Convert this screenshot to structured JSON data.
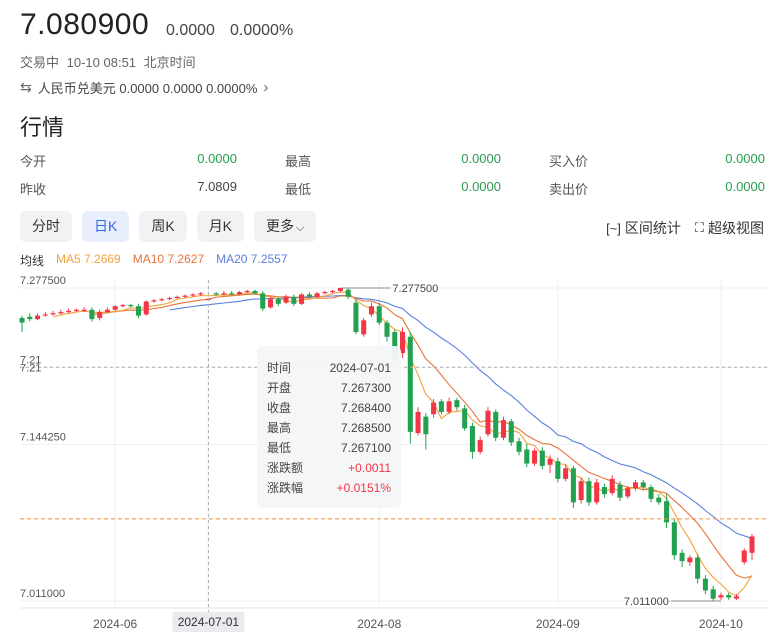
{
  "header": {
    "price": "7.080900",
    "change": "0.0000",
    "change_pct": "0.0000%",
    "status": "交易中",
    "datetime": "10-10 08:51",
    "timezone": "北京时间",
    "pair_icon": "swap-icon",
    "pair_text": "人民币兑美元 0.0000 0.0000 0.0000%"
  },
  "section_title": "行情",
  "quote": [
    {
      "label": "今开",
      "value": "0.0000"
    },
    {
      "label": "最高",
      "value": "0.0000"
    },
    {
      "label": "买入价",
      "value": "0.0000"
    },
    {
      "label": "昨收",
      "value": "7.0809"
    },
    {
      "label": "最低",
      "value": "0.0000"
    },
    {
      "label": "卖出价",
      "value": "0.0000"
    }
  ],
  "tabs": [
    "分时",
    "日K",
    "周K",
    "月K",
    "更多"
  ],
  "active_tab": "日K",
  "tools": {
    "range_stats": "区间统计",
    "super_view": "超级视图"
  },
  "ma": {
    "label": "均线",
    "ma5": "MA5 7.2669",
    "ma10": "MA10 7.2627",
    "ma20": "MA20 7.2557"
  },
  "colors": {
    "up": "#f23645",
    "down": "#22a150",
    "ma5": "#f3a33b",
    "ma10": "#e8743b",
    "ma20": "#5b7fe0",
    "accent": "#3366dd"
  },
  "tooltip": {
    "rows": [
      {
        "k": "时间",
        "v": "2024-07-01"
      },
      {
        "k": "开盘",
        "v": "7.267300"
      },
      {
        "k": "收盘",
        "v": "7.268400"
      },
      {
        "k": "最高",
        "v": "7.268500"
      },
      {
        "k": "最低",
        "v": "7.267100"
      },
      {
        "k": "涨跌额",
        "v": "+0.0011"
      },
      {
        "k": "涨跌幅",
        "v": "+0.0151%"
      }
    ]
  },
  "chart_data": {
    "type": "candlestick",
    "y_ticks": [
      "7.277500",
      "7.21",
      "7.144250",
      "7.011000"
    ],
    "x_ticks": [
      "2024-06",
      "2024-07-01",
      "2024-08",
      "2024-09",
      "2024-10"
    ],
    "ylim": [
      7.011,
      7.2775
    ],
    "high_marker": "7.277500",
    "low_marker": "7.011000",
    "crosshair_x_label": "2024-07-01",
    "crosshair_y_label": "7.21",
    "candles": [
      [
        7.252,
        7.248,
        7.254,
        7.24
      ],
      [
        7.253,
        7.251,
        7.256,
        7.249
      ],
      [
        7.251,
        7.254,
        7.256,
        7.25
      ],
      [
        7.254,
        7.255,
        7.257,
        7.253
      ],
      [
        7.255,
        7.256,
        7.258,
        7.254
      ],
      [
        7.256,
        7.257,
        7.259,
        7.255
      ],
      [
        7.257,
        7.258,
        7.26,
        7.256
      ],
      [
        7.258,
        7.259,
        7.26,
        7.257
      ],
      [
        7.258,
        7.259,
        7.261,
        7.257
      ],
      [
        7.259,
        7.251,
        7.261,
        7.249
      ],
      [
        7.252,
        7.257,
        7.259,
        7.25
      ],
      [
        7.257,
        7.259,
        7.261,
        7.256
      ],
      [
        7.259,
        7.262,
        7.263,
        7.258
      ],
      [
        7.262,
        7.263,
        7.264,
        7.261
      ],
      [
        7.263,
        7.262,
        7.264,
        7.261
      ],
      [
        7.262,
        7.254,
        7.264,
        7.252
      ],
      [
        7.255,
        7.266,
        7.267,
        7.254
      ],
      [
        7.266,
        7.267,
        7.268,
        7.265
      ],
      [
        7.267,
        7.268,
        7.269,
        7.266
      ],
      [
        7.268,
        7.269,
        7.27,
        7.267
      ],
      [
        7.269,
        7.27,
        7.271,
        7.268
      ],
      [
        7.27,
        7.271,
        7.272,
        7.269
      ],
      [
        7.271,
        7.272,
        7.273,
        7.27
      ],
      [
        7.272,
        7.273,
        7.274,
        7.271
      ],
      [
        7.2673,
        7.2684,
        7.2685,
        7.2671
      ],
      [
        7.273,
        7.272,
        7.274,
        7.271
      ],
      [
        7.272,
        7.273,
        7.275,
        7.271
      ],
      [
        7.273,
        7.272,
        7.275,
        7.271
      ],
      [
        7.272,
        7.274,
        7.275,
        7.271
      ],
      [
        7.274,
        7.275,
        7.276,
        7.273
      ],
      [
        7.275,
        7.273,
        7.276,
        7.272
      ],
      [
        7.273,
        7.26,
        7.275,
        7.258
      ],
      [
        7.261,
        7.268,
        7.27,
        7.26
      ],
      [
        7.268,
        7.264,
        7.27,
        7.262
      ],
      [
        7.265,
        7.27,
        7.272,
        7.264
      ],
      [
        7.27,
        7.264,
        7.272,
        7.262
      ],
      [
        7.264,
        7.272,
        7.273,
        7.263
      ],
      [
        7.272,
        7.27,
        7.274,
        7.269
      ],
      [
        7.27,
        7.273,
        7.274,
        7.269
      ],
      [
        7.273,
        7.274,
        7.275,
        7.272
      ],
      [
        7.274,
        7.275,
        7.276,
        7.273
      ],
      [
        7.275,
        7.2775,
        7.2775,
        7.274
      ],
      [
        7.276,
        7.27,
        7.277,
        7.268
      ],
      [
        7.265,
        7.24,
        7.268,
        7.238
      ],
      [
        7.238,
        7.25,
        7.252,
        7.236
      ],
      [
        7.255,
        7.262,
        7.265,
        7.253
      ],
      [
        7.262,
        7.248,
        7.265,
        7.246
      ],
      [
        7.248,
        7.236,
        7.25,
        7.232
      ],
      [
        7.24,
        7.215,
        7.242,
        7.212
      ],
      [
        7.222,
        7.24,
        7.244,
        7.218
      ],
      [
        7.236,
        7.155,
        7.24,
        7.145
      ],
      [
        7.154,
        7.172,
        7.176,
        7.152
      ],
      [
        7.168,
        7.153,
        7.171,
        7.14
      ],
      [
        7.17,
        7.18,
        7.183,
        7.167
      ],
      [
        7.181,
        7.172,
        7.183,
        7.17
      ],
      [
        7.172,
        7.181,
        7.184,
        7.17
      ],
      [
        7.182,
        7.176,
        7.184,
        7.173
      ],
      [
        7.175,
        7.158,
        7.178,
        7.156
      ],
      [
        7.16,
        7.138,
        7.163,
        7.132
      ],
      [
        7.138,
        7.148,
        7.151,
        7.136
      ],
      [
        7.153,
        7.173,
        7.176,
        7.151
      ],
      [
        7.172,
        7.15,
        7.174,
        7.147
      ],
      [
        7.15,
        7.165,
        7.168,
        7.148
      ],
      [
        7.164,
        7.146,
        7.166,
        7.143
      ],
      [
        7.147,
        7.138,
        7.15,
        7.135
      ],
      [
        7.14,
        7.128,
        7.145,
        7.125
      ],
      [
        7.128,
        7.139,
        7.141,
        7.126
      ],
      [
        7.139,
        7.126,
        7.142,
        7.123
      ],
      [
        7.127,
        7.132,
        7.135,
        7.12
      ],
      [
        7.13,
        7.115,
        7.133,
        7.112
      ],
      [
        7.115,
        7.124,
        7.127,
        7.113
      ],
      [
        7.124,
        7.095,
        7.126,
        7.09
      ],
      [
        7.097,
        7.113,
        7.116,
        7.094
      ],
      [
        7.113,
        7.095,
        7.116,
        7.092
      ],
      [
        7.095,
        7.112,
        7.115,
        7.093
      ],
      [
        7.108,
        7.102,
        7.111,
        7.099
      ],
      [
        7.103,
        7.115,
        7.118,
        7.101
      ],
      [
        7.11,
        7.099,
        7.113,
        7.096
      ],
      [
        7.1,
        7.107,
        7.109,
        7.098
      ],
      [
        7.107,
        7.112,
        7.114,
        7.105
      ],
      [
        7.112,
        7.108,
        7.114,
        7.106
      ],
      [
        7.108,
        7.098,
        7.11,
        7.095
      ],
      [
        7.099,
        7.095,
        7.102,
        7.093
      ],
      [
        7.096,
        7.078,
        7.102,
        7.073
      ],
      [
        7.078,
        7.05,
        7.081,
        7.046
      ],
      [
        7.052,
        7.045,
        7.055,
        7.04
      ],
      [
        7.044,
        7.048,
        7.05,
        7.041
      ],
      [
        7.048,
        7.03,
        7.051,
        7.026
      ],
      [
        7.03,
        7.02,
        7.033,
        7.017
      ],
      [
        7.021,
        7.013,
        7.024,
        7.011
      ],
      [
        7.014,
        7.016,
        7.018,
        7.012
      ],
      [
        7.016,
        7.014,
        7.018,
        7.012
      ],
      [
        7.013,
        7.015,
        7.017,
        7.012
      ],
      [
        7.044,
        7.054,
        7.056,
        7.042
      ],
      [
        7.052,
        7.066,
        7.068,
        7.046
      ]
    ]
  }
}
